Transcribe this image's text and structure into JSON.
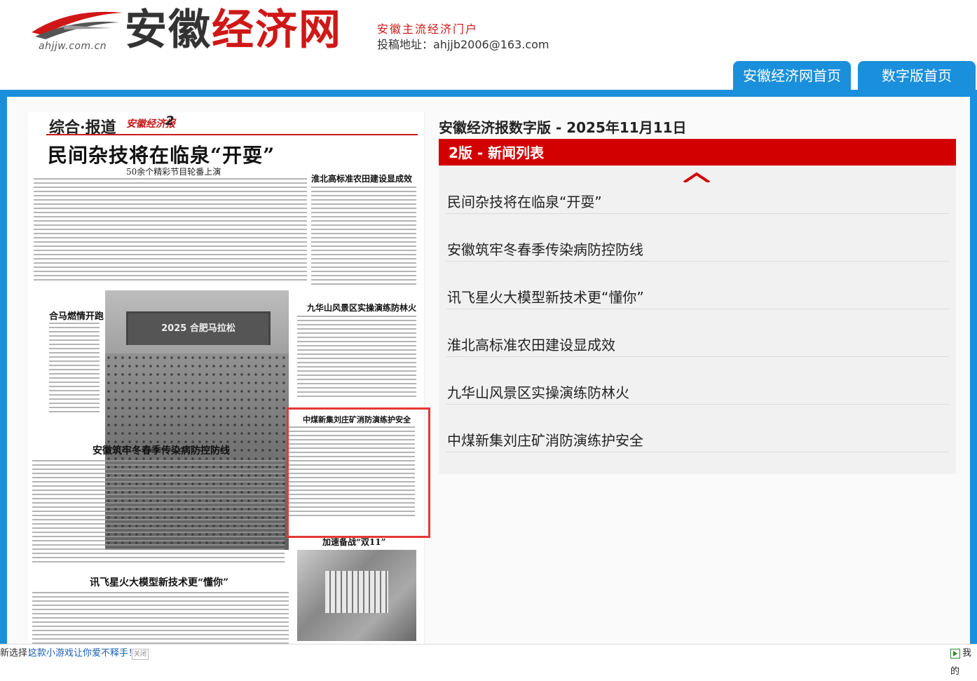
{
  "header": {
    "logo_url": "ahjjw.com.cn",
    "logo_name_part1": "安徽",
    "logo_name_part2": "经济网",
    "slogan": "安徽主流经济门户",
    "contact": "投稿地址：ahjjb2006@163.com",
    "tabs": [
      {
        "label": "安徽经济网首页"
      },
      {
        "label": "数字版首页"
      }
    ]
  },
  "newspaper": {
    "section_label": "综合·报道",
    "paper_logo": "安徽经济报",
    "page_number": "2",
    "headline": "民间杂技将在临泉“开耍”",
    "subheadline": "50余个精彩节目轮番上演",
    "articles": [
      {
        "title": "淮北高标准农田建设显成效"
      },
      {
        "title": "合马燃情开跑"
      },
      {
        "title": "九华山风景区实操演练防林火"
      },
      {
        "title": "中煤新集刘庄矿消防演练护安全"
      },
      {
        "title": "安徽筑牢冬春季传染病防控防线"
      },
      {
        "title": "加速备战“双11”"
      },
      {
        "title": "讯飞星火大模型新技术更“懂你”"
      }
    ]
  },
  "panel": {
    "title": "安徽经济报数字版 - 2025年11月11日",
    "list_header": "2版 - 新闻列表",
    "items": [
      {
        "label": "民间杂技将在临泉“开耍”"
      },
      {
        "label": "安徽筑牢冬春季传染病防控防线"
      },
      {
        "label": "讯飞星火大模型新技术更“懂你”"
      },
      {
        "label": "淮北高标准农田建设显成效"
      },
      {
        "label": "九华山风景区实操演练防林火"
      },
      {
        "label": "中煤新集刘庄矿消防演练护安全"
      }
    ]
  },
  "bottom_bar": {
    "label": "新选择：",
    "link": "这款小游戏让你爱不释手！",
    "close": "关闭",
    "right_text": "我的"
  },
  "colors": {
    "accent_blue": "#1a8fdb",
    "accent_red": "#d30000",
    "highlight_box": "#e53935"
  }
}
